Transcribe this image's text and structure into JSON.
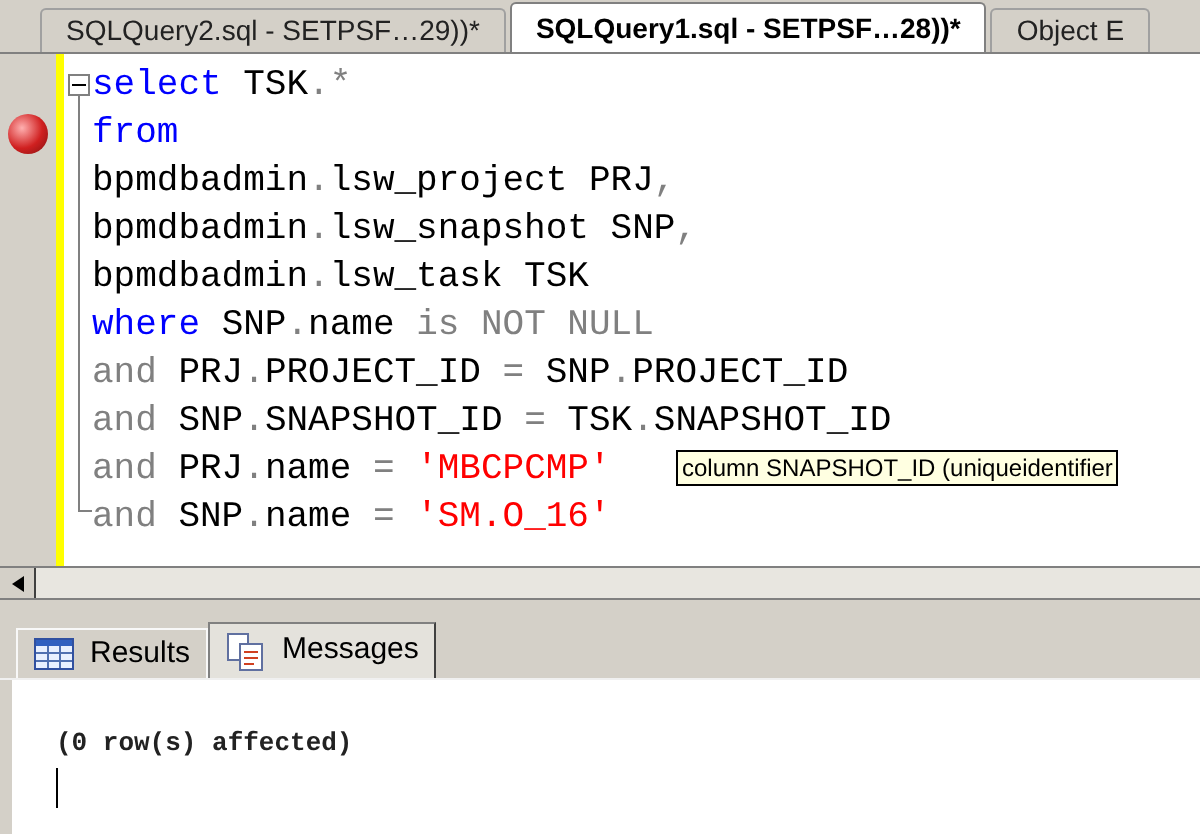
{
  "document_tabs": [
    {
      "label": "SQLQuery2.sql - SETPSF…29))*",
      "selected": false
    },
    {
      "label": "SQLQuery1.sql - SETPSF…28))*",
      "selected": true
    },
    {
      "label": "Object E",
      "selected": false
    }
  ],
  "editor": {
    "lines": [
      {
        "breakpoint": false,
        "tokens": [
          {
            "kind": "keyword",
            "text": "select"
          },
          {
            "kind": "text",
            "text": " TSK"
          },
          {
            "kind": "op",
            "text": ".*"
          }
        ]
      },
      {
        "breakpoint": true,
        "tokens": [
          {
            "kind": "keyword",
            "text": "from"
          }
        ]
      },
      {
        "breakpoint": false,
        "tokens": [
          {
            "kind": "text",
            "text": "bpmdbadmin"
          },
          {
            "kind": "op",
            "text": "."
          },
          {
            "kind": "text",
            "text": "lsw_project PRJ"
          },
          {
            "kind": "op",
            "text": ","
          }
        ]
      },
      {
        "breakpoint": false,
        "tokens": [
          {
            "kind": "text",
            "text": "bpmdbadmin"
          },
          {
            "kind": "op",
            "text": "."
          },
          {
            "kind": "text",
            "text": "lsw_snapshot SNP"
          },
          {
            "kind": "op",
            "text": ","
          }
        ]
      },
      {
        "breakpoint": false,
        "tokens": [
          {
            "kind": "text",
            "text": "bpmdbadmin"
          },
          {
            "kind": "op",
            "text": "."
          },
          {
            "kind": "text",
            "text": "lsw_task TSK"
          }
        ]
      },
      {
        "breakpoint": false,
        "tokens": [
          {
            "kind": "keyword",
            "text": "where"
          },
          {
            "kind": "text",
            "text": " SNP"
          },
          {
            "kind": "op",
            "text": "."
          },
          {
            "kind": "text",
            "text": "name"
          },
          {
            "kind": "op",
            "text": " is NOT NULL"
          }
        ]
      },
      {
        "breakpoint": false,
        "tokens": [
          {
            "kind": "op",
            "text": "and"
          },
          {
            "kind": "text",
            "text": " PRJ"
          },
          {
            "kind": "op",
            "text": "."
          },
          {
            "kind": "text",
            "text": "PROJECT_ID "
          },
          {
            "kind": "op",
            "text": "="
          },
          {
            "kind": "text",
            "text": " SNP"
          },
          {
            "kind": "op",
            "text": "."
          },
          {
            "kind": "text",
            "text": "PROJECT_ID"
          }
        ]
      },
      {
        "breakpoint": false,
        "tokens": [
          {
            "kind": "op",
            "text": "and"
          },
          {
            "kind": "text",
            "text": " SNP"
          },
          {
            "kind": "op",
            "text": "."
          },
          {
            "kind": "text",
            "text": "SNAPSHOT_ID "
          },
          {
            "kind": "op",
            "text": "="
          },
          {
            "kind": "text",
            "text": " TSK"
          },
          {
            "kind": "op",
            "text": "."
          },
          {
            "kind": "text",
            "text": "SNAPSHOT_ID"
          }
        ]
      },
      {
        "breakpoint": false,
        "tokens": [
          {
            "kind": "op",
            "text": "and"
          },
          {
            "kind": "text",
            "text": " PRJ"
          },
          {
            "kind": "op",
            "text": "."
          },
          {
            "kind": "text",
            "text": "name "
          },
          {
            "kind": "op",
            "text": "="
          },
          {
            "kind": "string",
            "text": " 'MBCPCMP'"
          }
        ]
      },
      {
        "breakpoint": false,
        "tokens": [
          {
            "kind": "op",
            "text": "and"
          },
          {
            "kind": "text",
            "text": " SNP"
          },
          {
            "kind": "op",
            "text": "."
          },
          {
            "kind": "text",
            "text": "name "
          },
          {
            "kind": "op",
            "text": "="
          },
          {
            "kind": "string",
            "text": " 'SM.O_16'"
          }
        ]
      }
    ],
    "tooltip": "column SNAPSHOT_ID (uniqueidentifier"
  },
  "result_tabs": [
    {
      "label": "Results",
      "selected": false
    },
    {
      "label": "Messages",
      "selected": true
    }
  ],
  "messages": "(0 row(s) affected)"
}
